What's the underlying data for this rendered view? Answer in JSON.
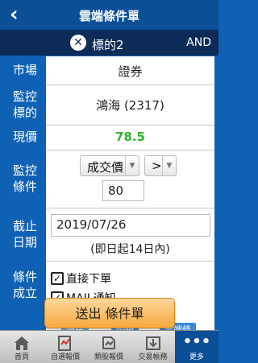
{
  "header": {
    "back_glyph": "‹",
    "title": "雲端條件單"
  },
  "subheader": {
    "remove_glyph": "✕",
    "target_label": "標的2",
    "logic_label": "AND"
  },
  "form": {
    "market": {
      "label": "市場",
      "value": "證券"
    },
    "monitor_target": {
      "label": "監控標的",
      "value": "鴻海 (2317)"
    },
    "current_price": {
      "label": "現價",
      "value": "78.5",
      "color": "#2db32d"
    },
    "monitor_condition": {
      "label": "監控條件",
      "field_select": "成交價",
      "operator_select": ">",
      "value": "80"
    },
    "deadline": {
      "label": "截止日期",
      "date": "2019/07/26",
      "note": "(即日起14日內)"
    },
    "trigger": {
      "label": "條件成立",
      "options": [
        {
          "label": "直接下單",
          "checked": true
        },
        {
          "label": "MAIL通知",
          "checked": true
        }
      ]
    }
  },
  "submit_button": {
    "label": "送出 條件單"
  },
  "peek_tabs": [
    "現在",
    "明細",
    "雲端條"
  ],
  "tabbar": {
    "items": [
      {
        "label": "首頁",
        "icon": "home-icon"
      },
      {
        "label": "自選報價",
        "icon": "watchlist-icon"
      },
      {
        "label": "類股報價",
        "icon": "category-quote-icon"
      },
      {
        "label": "交易帳務",
        "icon": "trade-account-icon"
      },
      {
        "label": "更多",
        "icon": "more-icon"
      }
    ]
  }
}
